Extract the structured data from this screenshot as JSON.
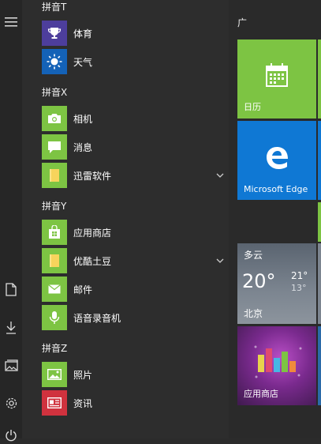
{
  "left_rail": {
    "items": [
      {
        "icon": "hamburger-menu-icon"
      },
      {
        "icon": "document-icon"
      },
      {
        "icon": "download-icon"
      },
      {
        "icon": "pictures-icon"
      },
      {
        "icon": "gear-icon"
      },
      {
        "icon": "power-icon"
      }
    ]
  },
  "app_list": {
    "groups": [
      {
        "header": "拼音T",
        "apps": [
          {
            "label": "体育",
            "icon": "trophy-icon",
            "color": "#4d3e9c"
          },
          {
            "label": "天气",
            "icon": "sun-icon",
            "color": "#1462b7"
          }
        ]
      },
      {
        "header": "拼音X",
        "apps": [
          {
            "label": "相机",
            "icon": "camera-icon",
            "color": "#7dc443"
          },
          {
            "label": "消息",
            "icon": "chat-icon",
            "color": "#7dc443"
          },
          {
            "label": "迅雷软件",
            "icon": "folder-icon",
            "color": "#7dc443",
            "expandable": true
          }
        ]
      },
      {
        "header": "拼音Y",
        "apps": [
          {
            "label": "应用商店",
            "icon": "store-bag-icon",
            "color": "#7dc443"
          },
          {
            "label": "优酷土豆",
            "icon": "folder-icon",
            "color": "#7dc443",
            "expandable": true
          },
          {
            "label": "邮件",
            "icon": "mail-icon",
            "color": "#7dc443"
          },
          {
            "label": "语音录音机",
            "icon": "microphone-icon",
            "color": "#7dc443"
          }
        ]
      },
      {
        "header": "拼音Z",
        "apps": [
          {
            "label": "照片",
            "icon": "photo-icon",
            "color": "#7dc443"
          },
          {
            "label": "资讯",
            "icon": "news-icon",
            "color": "#d0323e"
          }
        ]
      }
    ]
  },
  "tiles": {
    "group_title": "广",
    "calendar": {
      "label": "日历",
      "color": "#7dc443"
    },
    "edge": {
      "label": "Microsoft Edge",
      "color": "#0f78d4"
    },
    "weather": {
      "condition": "多云",
      "temp": "20°",
      "high": "21°",
      "low": "13°",
      "city": "北京"
    },
    "store": {
      "label": "应用商店"
    }
  }
}
